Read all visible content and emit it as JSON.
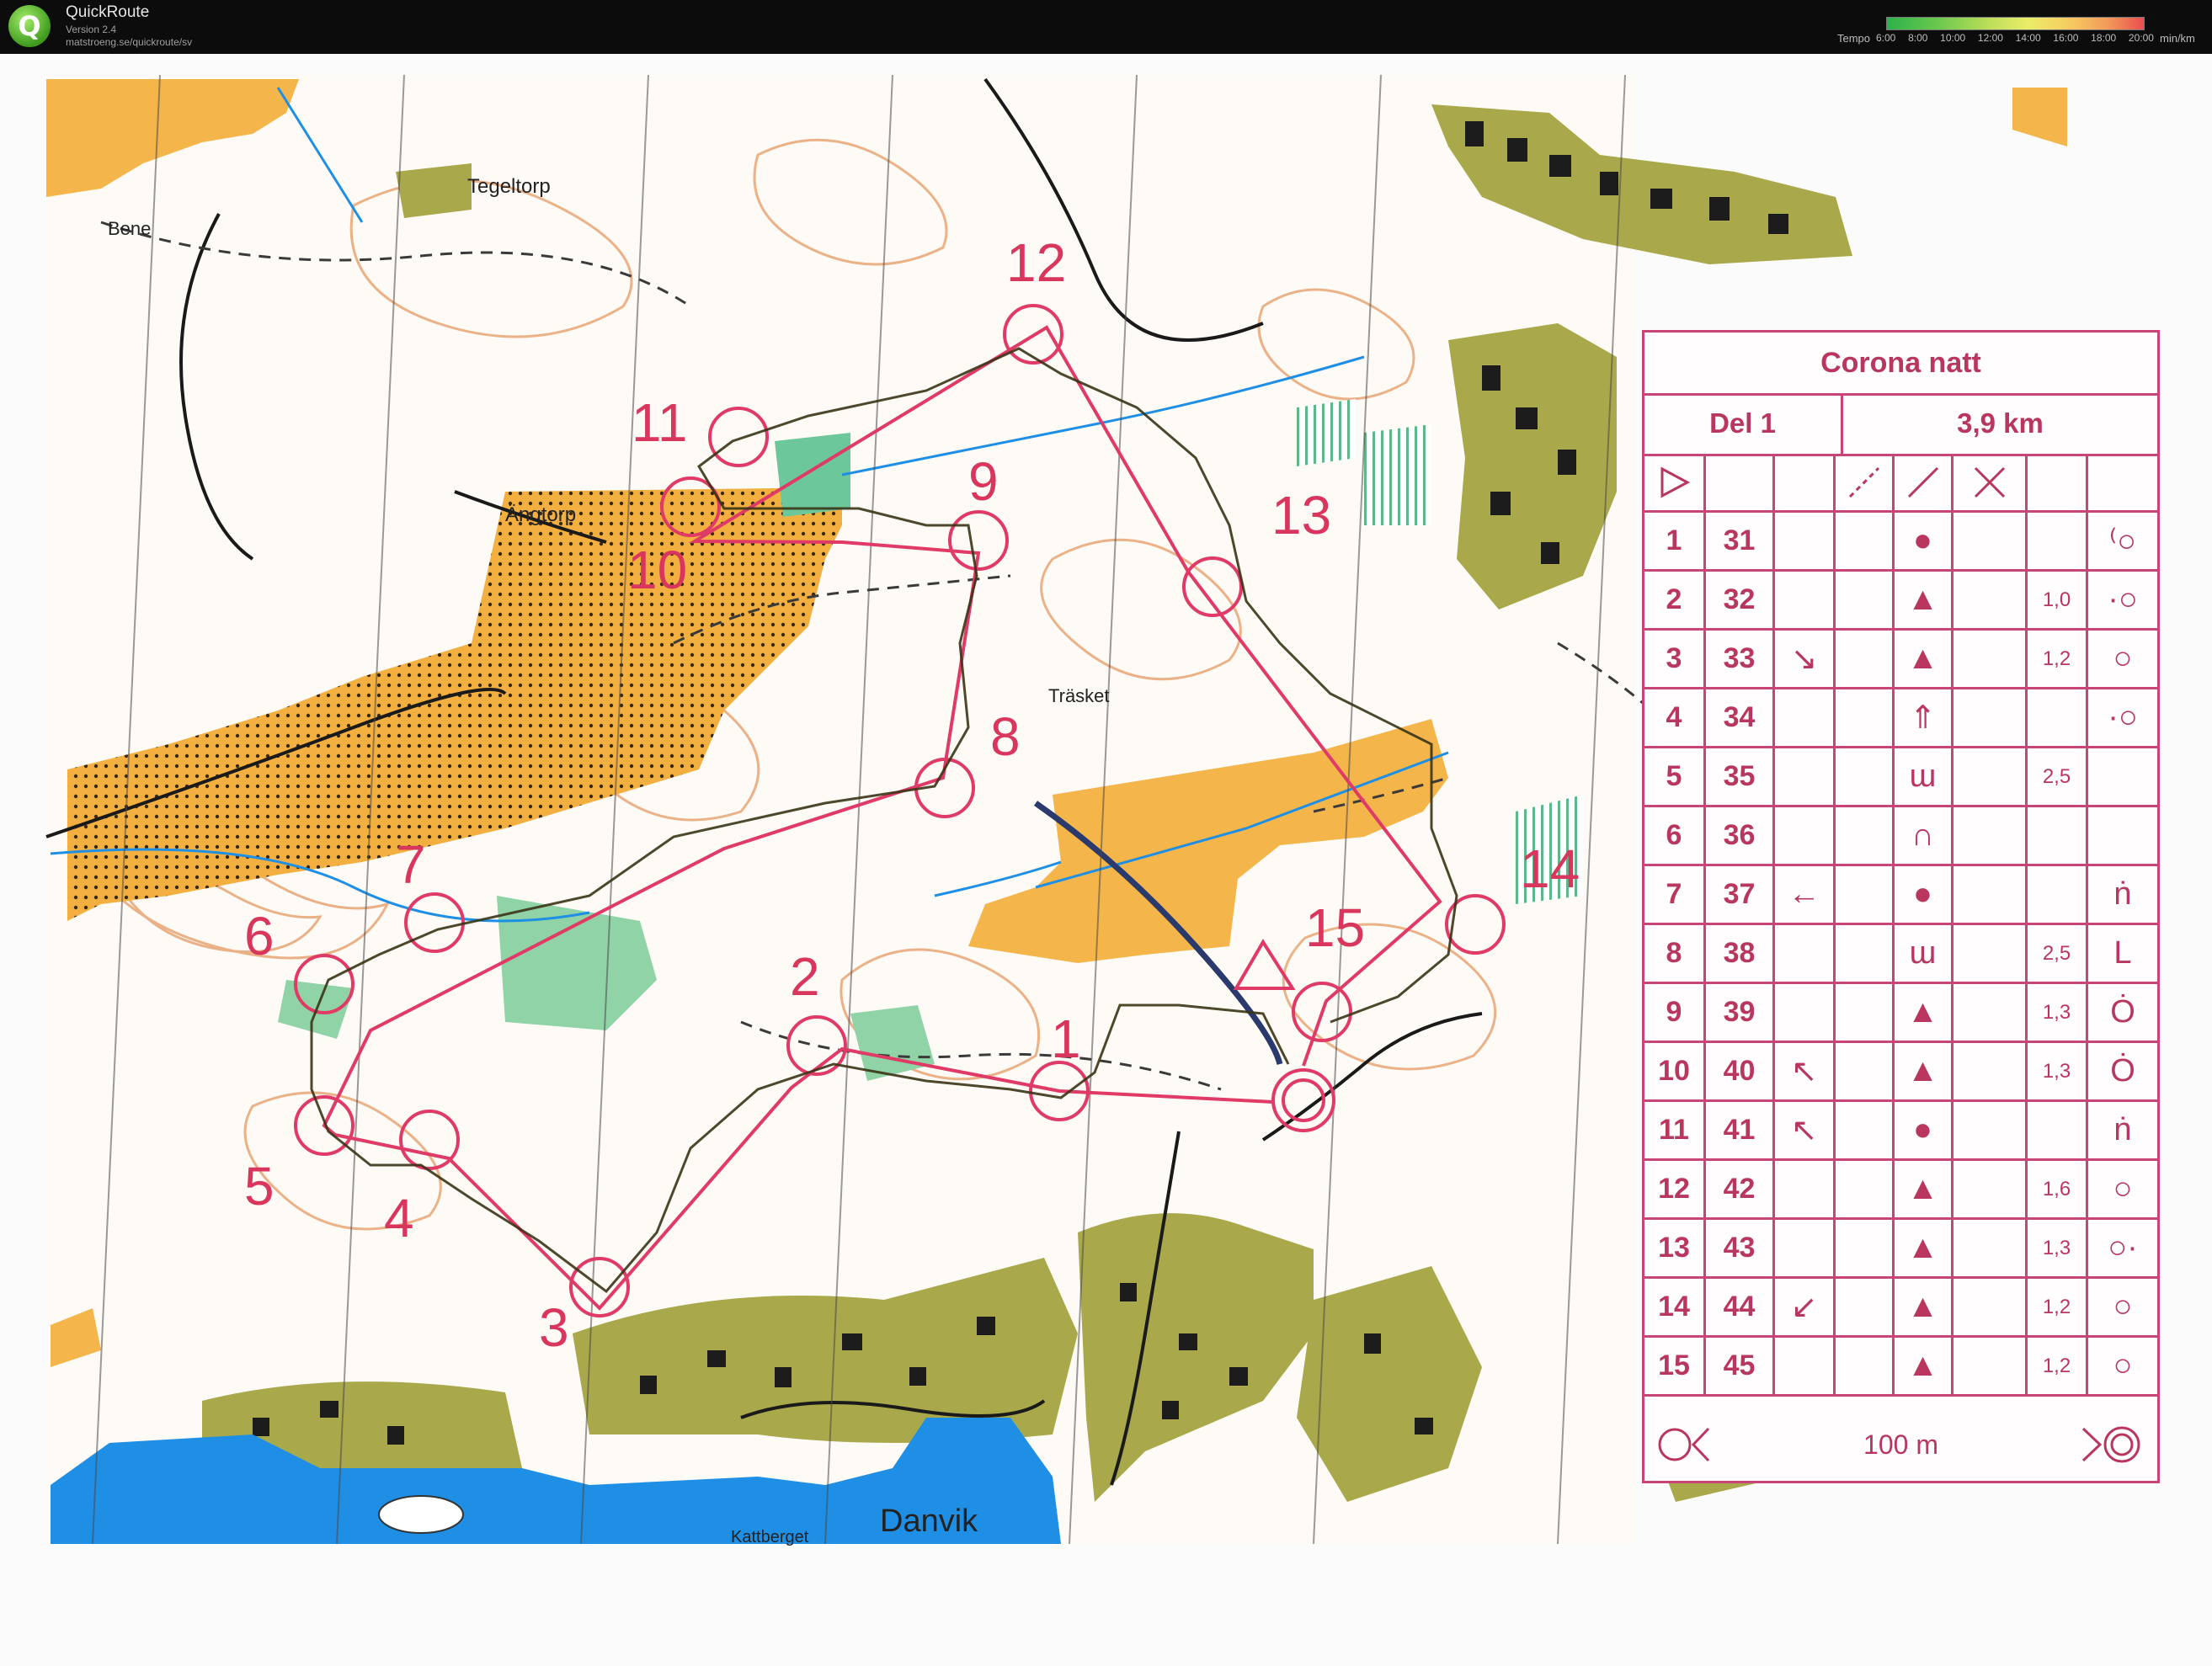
{
  "app": {
    "name": "QuickRoute",
    "version": "Version 2.4",
    "url": "matstroeng.se/quickroute/sv",
    "logo_letter": "Q"
  },
  "tempo_scale": {
    "label": "Tempo",
    "ticks": [
      "6:00",
      "8:00",
      "10:00",
      "12:00",
      "14:00",
      "16:00",
      "18:00",
      "20:00"
    ],
    "unit": "min/km"
  },
  "map": {
    "place_names": [
      "Tegeltorp",
      "Bene",
      "Ängtorp",
      "Träsket",
      "Kattberget",
      "Danvik"
    ],
    "colors": {
      "open_land": "#f4b54a",
      "vegetation": "#a9a84a",
      "water": "#1f8fe6",
      "contours": "#e0925f",
      "course": "#e03a67",
      "route": "#2a2a1a"
    },
    "controls": [
      {
        "num": "1"
      },
      {
        "num": "2"
      },
      {
        "num": "3"
      },
      {
        "num": "4"
      },
      {
        "num": "5"
      },
      {
        "num": "6"
      },
      {
        "num": "7"
      },
      {
        "num": "8"
      },
      {
        "num": "9"
      },
      {
        "num": "10"
      },
      {
        "num": "11"
      },
      {
        "num": "12"
      },
      {
        "num": "13"
      },
      {
        "num": "14"
      },
      {
        "num": "15"
      }
    ]
  },
  "description_sheet": {
    "title": "Corona natt",
    "leg": "Del 1",
    "length": "3,9 km",
    "header_symbols": [
      "start-triangle",
      "ford-symbol",
      "crossing-symbol",
      "junction-symbol"
    ],
    "rows": [
      {
        "seq": "1",
        "code": "31",
        "dir": "",
        "feature": "●",
        "dim": "",
        "loc": "⁽○"
      },
      {
        "seq": "2",
        "code": "32",
        "dir": "",
        "feature": "▲",
        "dim": "1,0",
        "loc": "·○"
      },
      {
        "seq": "3",
        "code": "33",
        "dir": "↘",
        "feature": "▲",
        "dim": "1,2",
        "loc": "○"
      },
      {
        "seq": "4",
        "code": "34",
        "dir": "",
        "feature": "⇑",
        "dim": "",
        "loc": "·○"
      },
      {
        "seq": "5",
        "code": "35",
        "dir": "",
        "feature": "ɯ",
        "dim": "2,5",
        "loc": ""
      },
      {
        "seq": "6",
        "code": "36",
        "dir": "",
        "feature": "∩",
        "dim": "",
        "loc": ""
      },
      {
        "seq": "7",
        "code": "37",
        "dir": "←",
        "feature": "●",
        "dim": "",
        "loc": "ṅ"
      },
      {
        "seq": "8",
        "code": "38",
        "dir": "",
        "feature": "ɯ",
        "dim": "2,5",
        "loc": "L"
      },
      {
        "seq": "9",
        "code": "39",
        "dir": "",
        "feature": "▲",
        "dim": "1,3",
        "loc": "Ȯ"
      },
      {
        "seq": "10",
        "code": "40",
        "dir": "↖",
        "feature": "▲",
        "dim": "1,3",
        "loc": "Ȯ"
      },
      {
        "seq": "11",
        "code": "41",
        "dir": "↖",
        "feature": "●",
        "dim": "",
        "loc": "ṅ"
      },
      {
        "seq": "12",
        "code": "42",
        "dir": "",
        "feature": "▲",
        "dim": "1,6",
        "loc": "○"
      },
      {
        "seq": "13",
        "code": "43",
        "dir": "",
        "feature": "▲",
        "dim": "1,3",
        "loc": "○·"
      },
      {
        "seq": "14",
        "code": "44",
        "dir": "↙",
        "feature": "▲",
        "dim": "1,2",
        "loc": "○"
      },
      {
        "seq": "15",
        "code": "45",
        "dir": "",
        "feature": "▲",
        "dim": "1,2",
        "loc": "○"
      }
    ],
    "finish_distance": "100 m"
  }
}
